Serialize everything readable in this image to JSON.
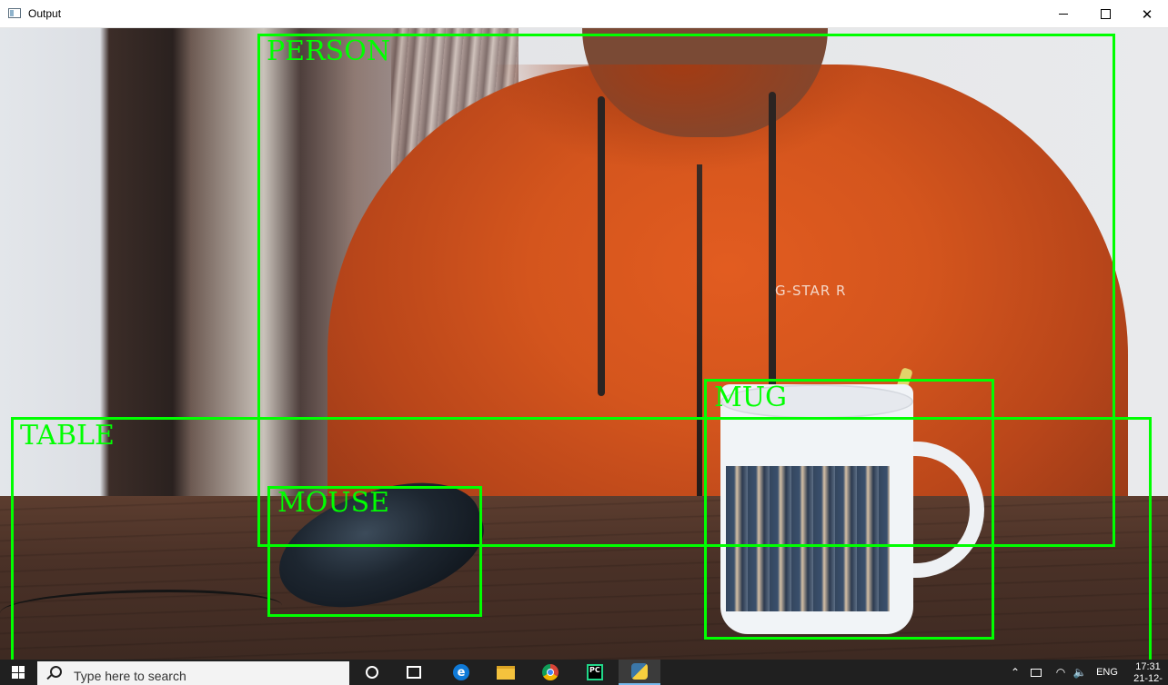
{
  "window": {
    "title": "Output",
    "icons": {
      "app": "app-window-icon",
      "minimize": "minimize-icon",
      "maximize": "maximize-icon",
      "close": "close-icon"
    },
    "close_glyph": "✕"
  },
  "detections": [
    {
      "label": "PERSON"
    },
    {
      "label": "TABLE"
    },
    {
      "label": "MOUSE"
    },
    {
      "label": "MUG"
    }
  ],
  "detection_color": "#00ff00",
  "scene": {
    "logo_text": "G-STAR R"
  },
  "taskbar": {
    "search_placeholder": "Type here to search",
    "pinned": [
      "cortana-icon",
      "task-view-icon",
      "edge-icon",
      "file-explorer-icon",
      "chrome-icon",
      "pycharm-icon",
      "python-icon"
    ],
    "pycharm_text": "PC",
    "edge_glyph": "e",
    "tray": {
      "overflow_glyph": "⌃",
      "volume_glyph": "🔈",
      "wifi_glyph": "◠",
      "language": "ENG",
      "time": "17:31",
      "date": "21-12-"
    }
  }
}
